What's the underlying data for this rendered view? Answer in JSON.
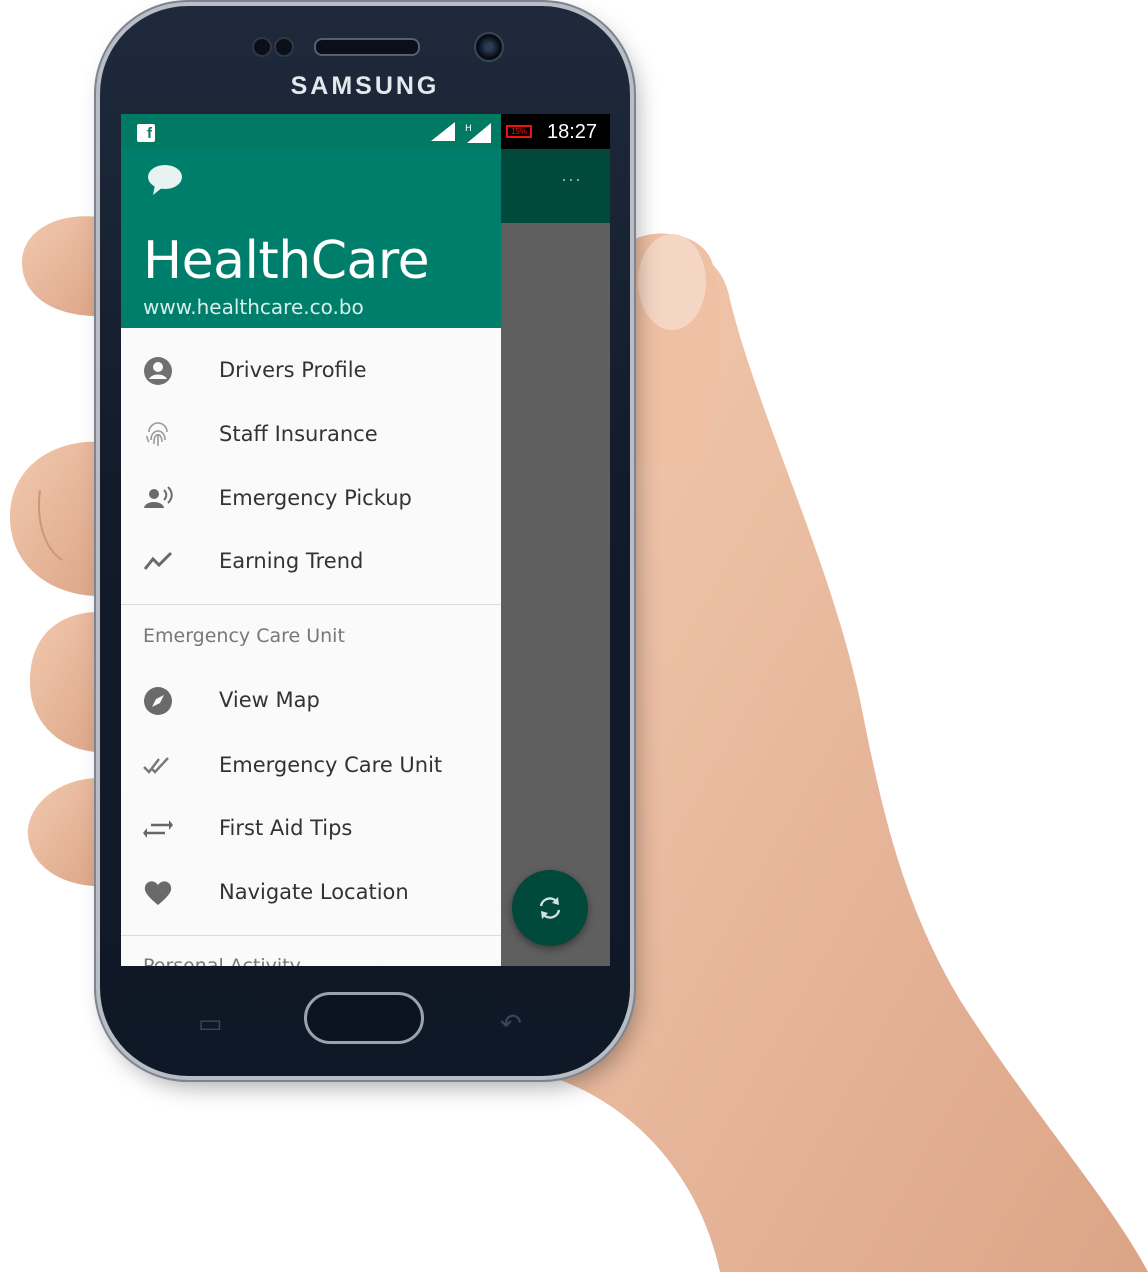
{
  "device": {
    "brand": "SAMSUNG"
  },
  "status_bar": {
    "notification_icon": "facebook-icon",
    "time": "18:27",
    "network": "H",
    "battery": "15%"
  },
  "app_bar": {
    "overflow_icon": "more-icon"
  },
  "drawer": {
    "header": {
      "icon": "chat-bubble-icon",
      "title": "HealthCare",
      "url": "www.healthcare.co.bo"
    },
    "items": [
      {
        "label": "Drivers Profile",
        "icon": "account-circle-icon"
      },
      {
        "label": "Staff Insurance",
        "icon": "fingerprint-icon"
      },
      {
        "label": "Emergency Pickup",
        "icon": "record-voice-icon"
      },
      {
        "label": "Earning Trend",
        "icon": "trending-icon"
      }
    ],
    "section": {
      "title": "Emergency Care Unit",
      "items": [
        {
          "label": "View Map",
          "icon": "compass-icon"
        },
        {
          "label": "Emergency Care Unit",
          "icon": "double-check-icon"
        },
        {
          "label": "First Aid Tips",
          "icon": "swap-arrows-icon"
        },
        {
          "label": "Navigate Location",
          "icon": "heart-icon"
        }
      ]
    },
    "next_section": {
      "title": "Personal Activity"
    }
  },
  "fab": {
    "icon": "refresh-icon"
  },
  "colors": {
    "primary": "#007e6c",
    "primary_dark": "#00493b",
    "status_bar": "#007a62",
    "scrim": "#5f5f5f"
  }
}
